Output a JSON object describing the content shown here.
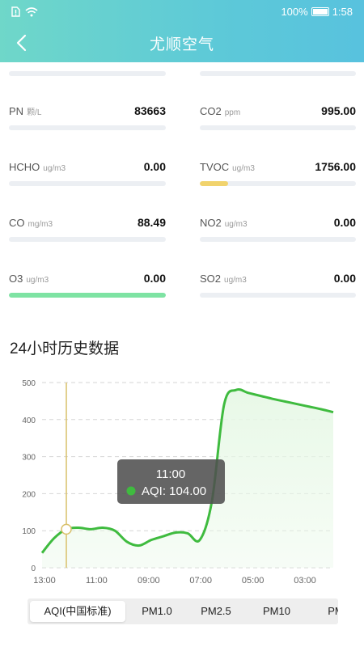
{
  "status": {
    "battery": "100%",
    "time": "1:58"
  },
  "header": {
    "title": "尤顺空气",
    "back_icon": "chevron-left-icon"
  },
  "metrics": [
    {
      "name": "PN",
      "unit": "颗/L",
      "value": "83663",
      "level": 0,
      "color": "#e9edf1"
    },
    {
      "name": "CO2",
      "unit": "ppm",
      "value": "995.00",
      "level": 0,
      "color": "#e9edf1"
    },
    {
      "name": "HCHO",
      "unit": "ug/m3",
      "value": "0.00",
      "level": 0,
      "color": "#e9edf1"
    },
    {
      "name": "TVOC",
      "unit": "ug/m3",
      "value": "1756.00",
      "level": 0.18,
      "color": "#f1d36d"
    },
    {
      "name": "CO",
      "unit": "mg/m3",
      "value": "88.49",
      "level": 0,
      "color": "#e9edf1"
    },
    {
      "name": "NO2",
      "unit": "ug/m3",
      "value": "0.00",
      "level": 0,
      "color": "#e9edf1"
    },
    {
      "name": "O3",
      "unit": "ug/m3",
      "value": "0.00",
      "level": 1,
      "color": "#7ee3a3"
    },
    {
      "name": "SO2",
      "unit": "ug/m3",
      "value": "0.00",
      "level": 0,
      "color": "#e9edf1"
    }
  ],
  "history": {
    "title": "24小时历史数据"
  },
  "chart_data": {
    "type": "area",
    "y_ticks": [
      "500",
      "400",
      "300",
      "200",
      "100",
      "0"
    ],
    "ylim": [
      0,
      500
    ],
    "x_tick_labels": [
      "13:00",
      "11:00",
      "09:00",
      "07:00",
      "05:00",
      "03:00"
    ],
    "x": [
      0,
      1,
      2,
      3,
      4,
      5,
      6,
      7,
      8,
      9,
      10,
      11,
      12,
      13,
      14,
      15,
      16,
      17,
      18,
      19,
      20,
      21,
      22,
      23,
      24
    ],
    "series": [
      {
        "values": [
          40,
          80,
          104,
          108,
          104,
          108,
          100,
          70,
          60,
          75,
          85,
          95,
          93,
          75,
          180,
          440,
          480,
          472,
          464,
          456,
          449,
          442,
          435,
          428,
          420
        ]
      }
    ],
    "highlight": {
      "index": 2,
      "title": "11:00",
      "label": "AQI: 104.00"
    },
    "colors": {
      "line": "#3fbb3f",
      "area": "#e7f8e6",
      "cursor": "#d9c06a",
      "grid": "#d6d6d6"
    }
  },
  "tabs": [
    {
      "label": "AQI(中国标准)",
      "active": true
    },
    {
      "label": "PM1.0",
      "active": false
    },
    {
      "label": "PM2.5",
      "active": false
    },
    {
      "label": "PM10",
      "active": false
    },
    {
      "label": "PM",
      "active": false
    }
  ]
}
